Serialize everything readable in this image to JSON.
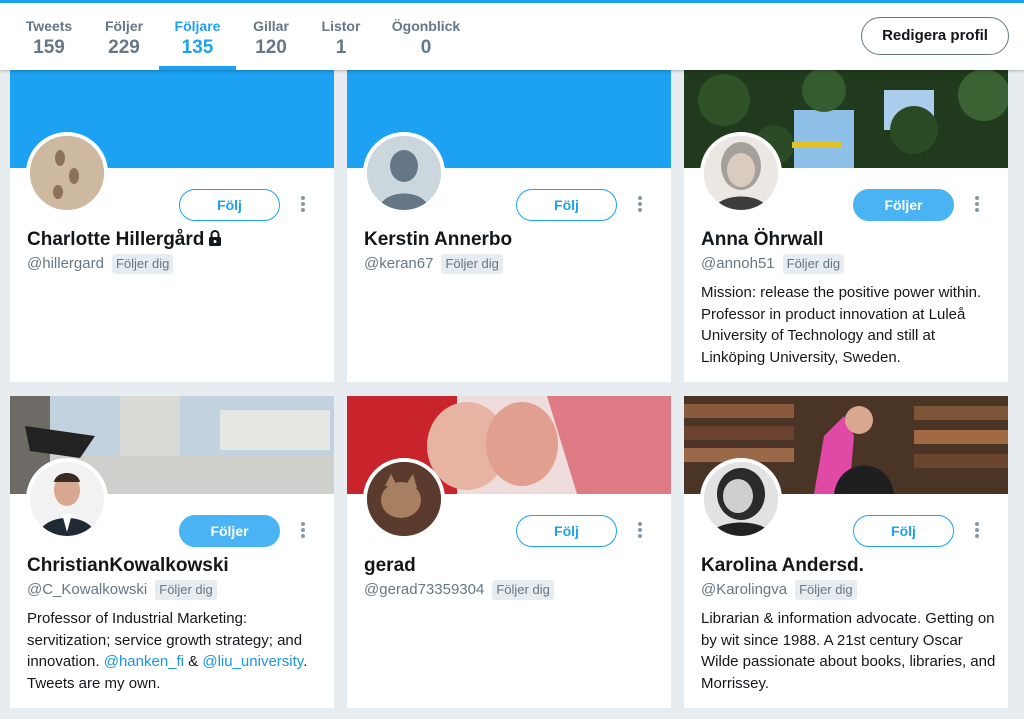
{
  "stats": [
    {
      "label": "Tweets",
      "value": "159",
      "active": false
    },
    {
      "label": "Följer",
      "value": "229",
      "active": false
    },
    {
      "label": "Följare",
      "value": "135",
      "active": true
    },
    {
      "label": "Gillar",
      "value": "120",
      "active": false
    },
    {
      "label": "Listor",
      "value": "1",
      "active": false
    },
    {
      "label": "Ögonblick",
      "value": "0",
      "active": false
    }
  ],
  "edit_profile_label": "Redigera profil",
  "cards": [
    {
      "name": "Charlotte Hillergård",
      "handle": "@hillergard",
      "follows_you": "Följer dig",
      "button": "Följ",
      "protected": true,
      "bio": ""
    },
    {
      "name": "Kerstin Annerbo",
      "handle": "@keran67",
      "follows_you": "Följer dig",
      "button": "Följ",
      "protected": false,
      "bio": ""
    },
    {
      "name": "Anna Öhrwall",
      "handle": "@annoh51",
      "follows_you": "Följer dig",
      "button": "Följer",
      "protected": false,
      "bio": "Mission: release the positive power within. Professor in product innovation at Luleå University of Technology and still at Linköping University, Sweden."
    },
    {
      "name": "ChristianKowalkowski",
      "handle": "@C_Kowalkowski",
      "follows_you": "Följer dig",
      "button": "Följer",
      "protected": false,
      "bio_before": "Professor of Industrial Marketing: servitization; service growth strategy; and innovation. ",
      "bio_link1": "@hanken_fi",
      "bio_mid": " & ",
      "bio_link2": "@liu_university",
      "bio_after": ". Tweets are my own."
    },
    {
      "name": "gerad",
      "handle": "@gerad73359304",
      "follows_you": "Följer dig",
      "button": "Följ",
      "protected": false,
      "bio": ""
    },
    {
      "name": "Karolina Andersd.",
      "handle": "@Karolingva",
      "follows_you": "Följer dig",
      "button": "Följ",
      "protected": false,
      "bio": "Librarian & information advocate. Getting on by wit since 1988. A 21st century Oscar Wilde passionate about books, libraries, and Morrissey."
    }
  ]
}
